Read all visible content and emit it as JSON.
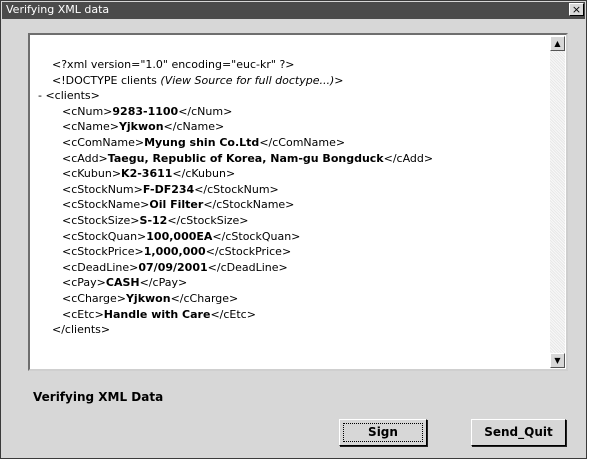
{
  "window": {
    "title": "Verifying XML data",
    "close_label": "×"
  },
  "xml_lines": [
    {
      "parts": [
        {
          "t": "<?xml version=\"1.0\" encoding=\"euc-kr\" ?>",
          "s": "n"
        }
      ]
    },
    {
      "parts": [
        {
          "t": "<!DOCTYPE clients ",
          "s": "n"
        },
        {
          "t": "(View Source for full doctype...)",
          "s": "i"
        },
        {
          "t": ">",
          "s": "n"
        }
      ]
    },
    {
      "parts": [
        {
          "t": "- <clients>",
          "s": "n"
        }
      ]
    },
    {
      "parts": [
        {
          "t": "<cNum>",
          "s": "n"
        },
        {
          "t": "9283-1100",
          "s": "b"
        },
        {
          "t": "</cNum>",
          "s": "n"
        }
      ]
    },
    {
      "parts": [
        {
          "t": "<cName>",
          "s": "n"
        },
        {
          "t": "Yjkwon",
          "s": "b"
        },
        {
          "t": "</cName>",
          "s": "n"
        }
      ]
    },
    {
      "parts": [
        {
          "t": "<cComName>",
          "s": "n"
        },
        {
          "t": "Myung shin Co.Ltd",
          "s": "b"
        },
        {
          "t": "</cComName>",
          "s": "n"
        }
      ]
    },
    {
      "parts": [
        {
          "t": "<cAdd>",
          "s": "n"
        },
        {
          "t": "Taegu, Republic of Korea, Nam-gu Bongduck",
          "s": "b"
        },
        {
          "t": "</cAdd>",
          "s": "n"
        }
      ]
    },
    {
      "parts": [
        {
          "t": "<cKubun>",
          "s": "n"
        },
        {
          "t": "K2-3611",
          "s": "b"
        },
        {
          "t": "</cKubun>",
          "s": "n"
        }
      ]
    },
    {
      "parts": [
        {
          "t": "<cStockNum>",
          "s": "n"
        },
        {
          "t": "F-DF234",
          "s": "b"
        },
        {
          "t": "</cStockNum>",
          "s": "n"
        }
      ]
    },
    {
      "parts": [
        {
          "t": "<cStockName>",
          "s": "n"
        },
        {
          "t": "Oil Filter",
          "s": "b"
        },
        {
          "t": "</cStockName>",
          "s": "n"
        }
      ]
    },
    {
      "parts": [
        {
          "t": "<cStockSize>",
          "s": "n"
        },
        {
          "t": "S-12",
          "s": "b"
        },
        {
          "t": "</cStockSize>",
          "s": "n"
        }
      ]
    },
    {
      "parts": [
        {
          "t": "<cStockQuan>",
          "s": "n"
        },
        {
          "t": "100,000EA",
          "s": "b"
        },
        {
          "t": "</cStockQuan>",
          "s": "n"
        }
      ]
    },
    {
      "parts": [
        {
          "t": "<cStockPrice>",
          "s": "n"
        },
        {
          "t": "1,000,000",
          "s": "b"
        },
        {
          "t": "</cStockPrice>",
          "s": "n"
        }
      ]
    },
    {
      "parts": [
        {
          "t": "<cDeadLine>",
          "s": "n"
        },
        {
          "t": "07/09/2001",
          "s": "b"
        },
        {
          "t": "</cDeadLine>",
          "s": "n"
        }
      ]
    },
    {
      "parts": [
        {
          "t": "<cPay>",
          "s": "n"
        },
        {
          "t": "CASH",
          "s": "b"
        },
        {
          "t": "</cPay>",
          "s": "n"
        }
      ]
    },
    {
      "parts": [
        {
          "t": "<cCharge>",
          "s": "n"
        },
        {
          "t": "Yjkwon",
          "s": "b"
        },
        {
          "t": "</cCharge>",
          "s": "n"
        }
      ]
    },
    {
      "parts": [
        {
          "t": "<cEtc>",
          "s": "n"
        },
        {
          "t": "Handle with Care",
          "s": "b"
        },
        {
          "t": "</cEtc>",
          "s": "n"
        }
      ]
    },
    {
      "parts": [
        {
          "t": "</clients>",
          "s": "n"
        }
      ]
    }
  ],
  "scrollbar": {
    "up_icon": "scroll-up-arrow-icon",
    "down_icon": "scroll-down-arrow-icon",
    "up_glyph": "▲",
    "down_glyph": "▼"
  },
  "status": {
    "text": "Verifying XML Data"
  },
  "buttons": {
    "sign_label": "Sign",
    "send_quit_label": "Send_Quit"
  }
}
